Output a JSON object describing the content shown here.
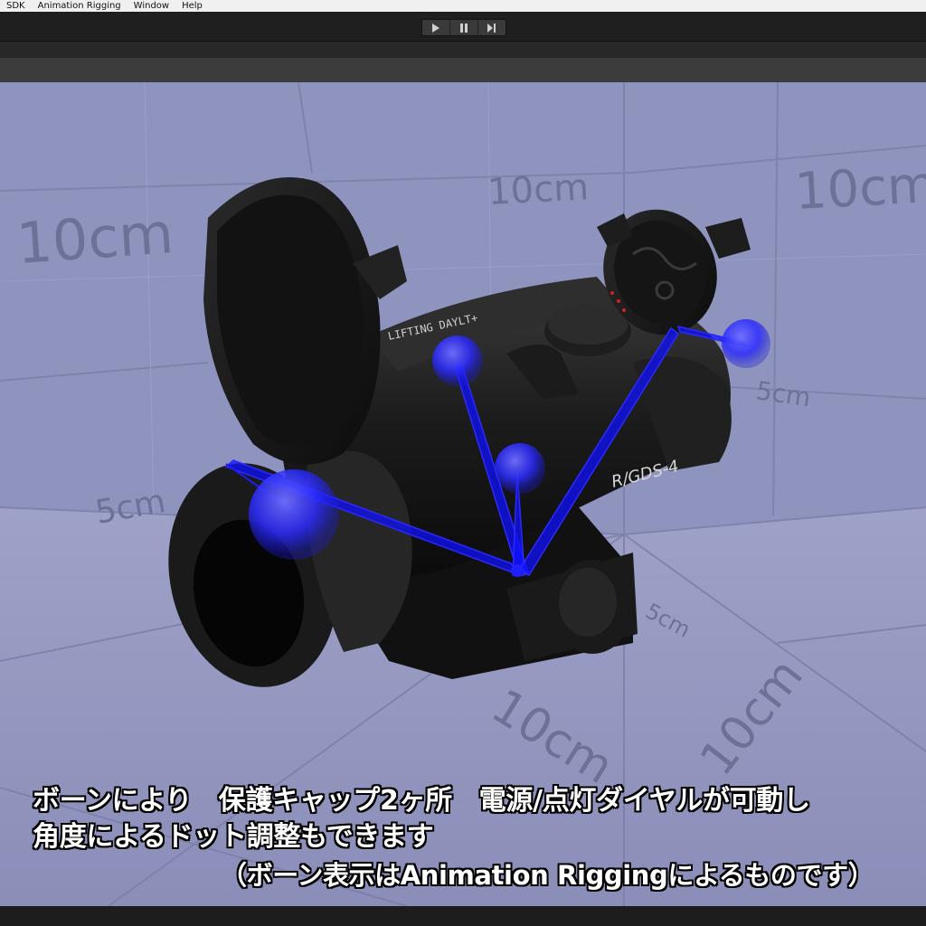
{
  "menu": {
    "items": [
      "SDK",
      "Animation Rigging",
      "Window",
      "Help"
    ]
  },
  "toolbar": {
    "play_icon": "play-icon",
    "pause_icon": "pause-icon",
    "step_icon": "step-icon"
  },
  "viewport": {
    "background_color": "#8a8fba",
    "grid_labels": {
      "back_left": "10cm",
      "back_center": "10cm",
      "back_right": "10cm",
      "left_mid": "5cm",
      "right_mid": "5cm",
      "floor_mid": "5cm",
      "floor_left": "10cm",
      "floor_right": "10cm"
    },
    "model": {
      "body_text": "R/GDS-4",
      "top_text": "LIFTING DAYLT+"
    },
    "bone_color": "#1a1aff"
  },
  "captions": {
    "line1": "ボーンにより　保護キャップ2ヶ所　電源/点灯ダイヤルが可動し",
    "line2": "角度によるドット調整もできます",
    "line3": "（ボーン表示はAnimation Riggingによるものです）"
  }
}
